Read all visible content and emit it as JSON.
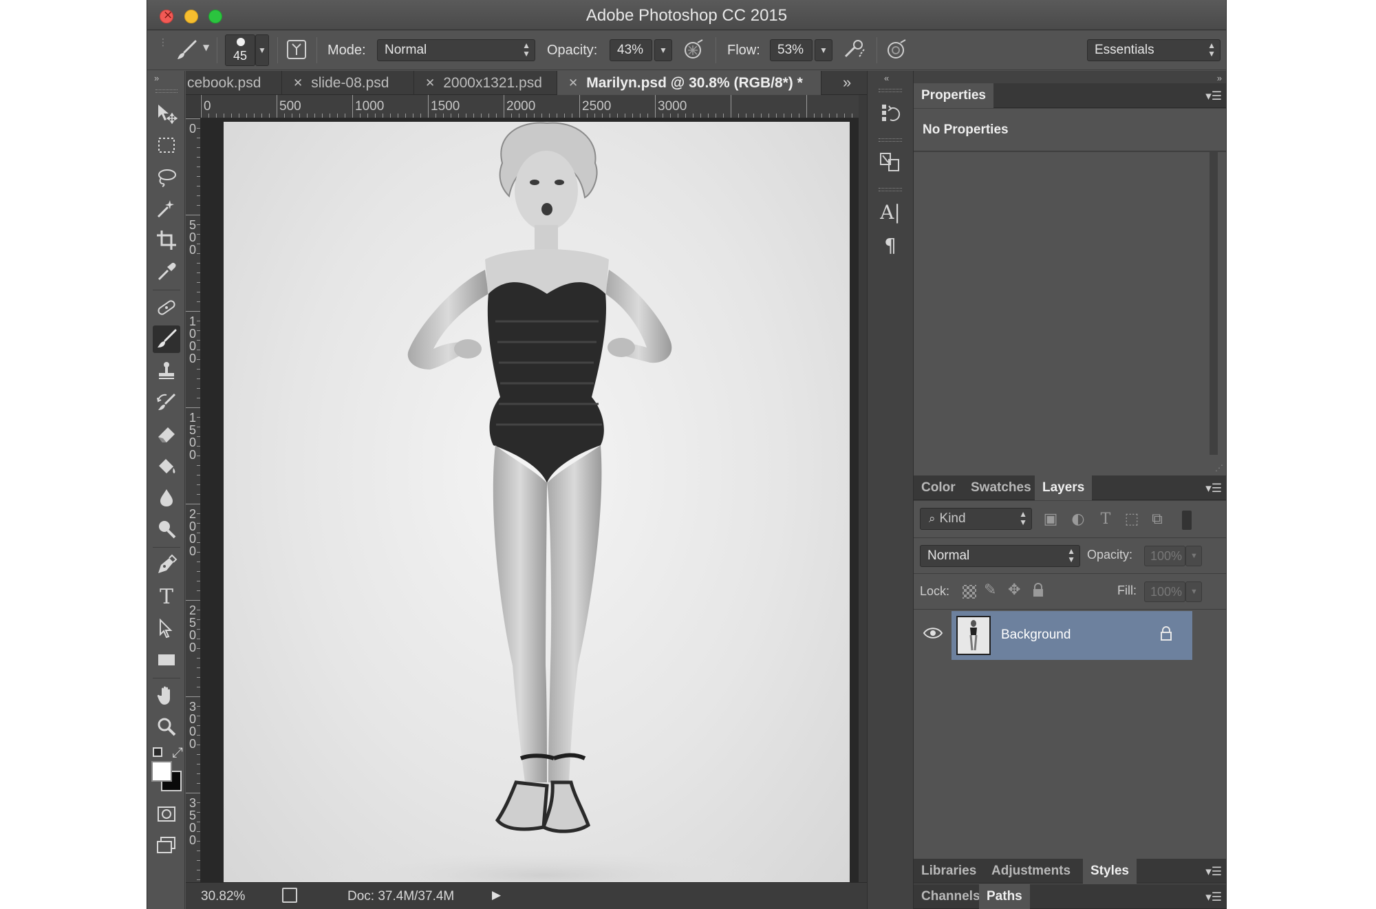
{
  "window": {
    "title": "Adobe Photoshop CC 2015"
  },
  "options_bar": {
    "brush_size": "45",
    "mode_label": "Mode:",
    "mode_value": "Normal",
    "opacity_label": "Opacity:",
    "opacity_value": "43%",
    "flow_label": "Flow:",
    "flow_value": "53%",
    "workspace": "Essentials"
  },
  "tabs": [
    {
      "label": "cebook.psd",
      "active": false
    },
    {
      "label": "slide-08.psd",
      "active": false
    },
    {
      "label": "2000x1321.psd",
      "active": false
    },
    {
      "label": "Marilyn.psd @ 30.8% (RGB/8*) *",
      "active": true
    }
  ],
  "ruler": {
    "horizontal": [
      "0",
      "500",
      "1000",
      "1500",
      "2000",
      "2500",
      "3000"
    ],
    "vertical": [
      "0",
      "500",
      "1000",
      "1500",
      "2000",
      "2500",
      "3000",
      "3500"
    ]
  },
  "status": {
    "zoom": "30.82%",
    "doc": "Doc: 37.4M/37.4M"
  },
  "tools": [
    "move-icon",
    "marquee-icon",
    "lasso-icon",
    "magic-wand-icon",
    "crop-icon",
    "eyedropper-icon",
    "healing-icon",
    "brush-icon",
    "stamp-icon",
    "history-brush-icon",
    "eraser-icon",
    "paint-bucket-icon",
    "blur-icon",
    "dodge-icon",
    "pen-icon",
    "type-icon",
    "path-select-icon",
    "rectangle-icon",
    "hand-icon",
    "zoom-icon"
  ],
  "properties_panel": {
    "tab": "Properties",
    "content": "No Properties"
  },
  "layers_panel": {
    "tabs": [
      "Color",
      "Swatches",
      "Layers"
    ],
    "active_tab": "Layers",
    "filter_kind": "Kind",
    "blend_mode": "Normal",
    "opacity_label": "Opacity:",
    "opacity_value": "100%",
    "lock_label": "Lock:",
    "fill_label": "Fill:",
    "fill_value": "100%",
    "layers": [
      {
        "name": "Background",
        "visible": true,
        "locked": true,
        "selected": true
      }
    ]
  },
  "bottom_panels": {
    "row1_tabs": [
      "Libraries",
      "Adjustments",
      "Styles"
    ],
    "row1_active": "Styles",
    "row2_tabs": [
      "Channels",
      "Paths"
    ],
    "row2_active": "Paths"
  },
  "colors": {
    "ui_bg": "#535353",
    "panel_dark": "#424242",
    "selected_layer": "#6d819e",
    "close_red": "#f25a55",
    "minimize_yellow": "#f6be2f",
    "zoom_green": "#2bc43f"
  }
}
